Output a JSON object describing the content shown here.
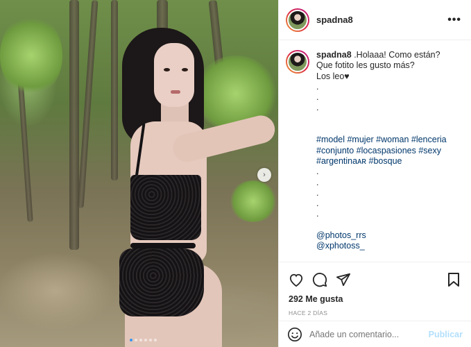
{
  "post": {
    "username": "spadna8",
    "more_label": "•••",
    "carousel": {
      "next_arrow": "›",
      "slide_count": 6,
      "active_index": 0
    }
  },
  "caption": {
    "username": "spadna8",
    "line1": ".Holaaa! Como están?",
    "line2": "Que fotito les gusto más?",
    "line3": "Los leo♥",
    "dot": ".",
    "tags_line1": "#model #mujer #woman #lenceria",
    "tags_line2": "#conjunto #locaspasiones #sexy",
    "tags_line3": "#argentinaᴀʀ #bosque",
    "mention1": "@photos_rrs",
    "mention2": "@xphotoss_"
  },
  "actions": {
    "icons": [
      "heart-icon",
      "comment-icon",
      "share-icon",
      "bookmark-icon"
    ]
  },
  "likes": "292 Me gusta",
  "time_ago": "HACE 2 DÍAS",
  "comment": {
    "placeholder": "Añade un comentario...",
    "publish_label": "Publicar"
  },
  "colors": {
    "link": "#00376b",
    "publish_disabled": "#b2dffc",
    "meta_gray": "#8e8e8e",
    "story_ring_start": "#f09433",
    "story_ring_end": "#bc1888"
  }
}
